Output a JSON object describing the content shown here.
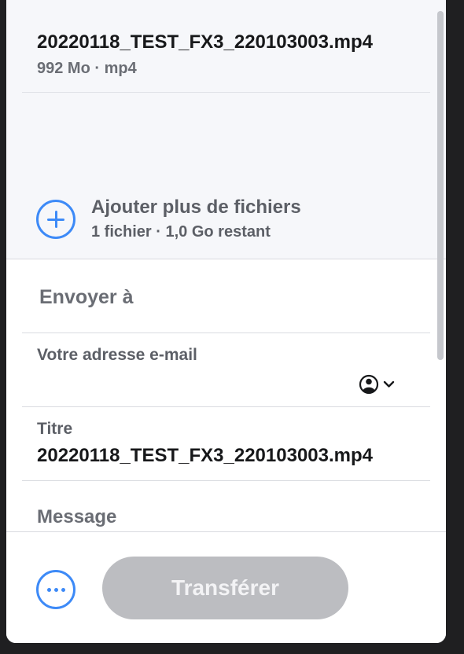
{
  "files": {
    "items": [
      {
        "name": "20220118_TEST_FX3_220103003.mp4",
        "meta": "992 Mo · mp4"
      }
    ],
    "add_more": {
      "label": "Ajouter plus de fichiers",
      "status": "1 fichier · 1,0 Go restant"
    }
  },
  "form": {
    "send_to_label": "Envoyer à",
    "email_label": "Votre adresse e-mail",
    "title_label": "Titre",
    "title_value": "20220118_TEST_FX3_220103003.mp4",
    "message_label": "Message"
  },
  "footer": {
    "transfer_label": "Transférer"
  },
  "colors": {
    "accent": "#3d8af7",
    "disabled_button": "#bcbdc1"
  },
  "icons": {
    "add": "plus-circle-icon",
    "contact": "user-circle-icon",
    "dropdown": "chevron-down-icon",
    "more": "more-horizontal-icon"
  }
}
